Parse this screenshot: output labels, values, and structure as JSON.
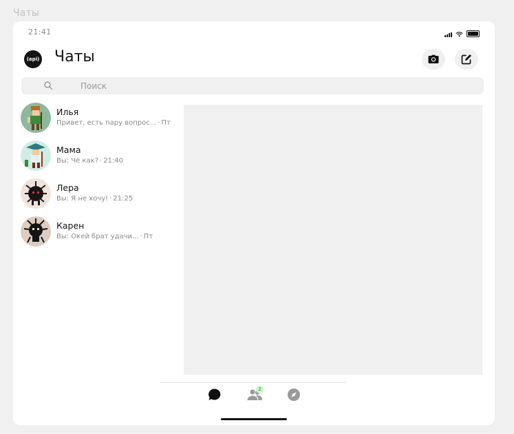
{
  "page_label": "Чаты",
  "status_bar": {
    "time": "21:41",
    "icons": [
      "signal-icon",
      "wifi-icon",
      "battery-icon"
    ]
  },
  "header": {
    "logo_text": "(api)",
    "title": "Чаты",
    "buttons": [
      "camera-icon",
      "compose-icon"
    ]
  },
  "search": {
    "placeholder": "Поиск"
  },
  "chats": [
    {
      "name": "Илья",
      "preview": "Привет, есть пару вопрос...",
      "time": "Пт"
    },
    {
      "name": "Мама",
      "preview": "Вы: Чё как?",
      "time": "21:40"
    },
    {
      "name": "Лера",
      "preview": "Вы: Я не хочу!",
      "time": "21:25"
    },
    {
      "name": "Карен",
      "preview": "Вы: Окей брат удачи...",
      "time": "Пт"
    }
  ],
  "tabbar": {
    "tabs": [
      "chat-bubble-icon",
      "contacts-icon",
      "compass-icon"
    ],
    "contacts_badge": "2"
  },
  "colors": {
    "background": "#f0f0f0",
    "surface": "#ffffff",
    "text_primary": "#111111",
    "text_secondary": "#8a8a8a",
    "badge_bg": "#c9f3c9"
  }
}
